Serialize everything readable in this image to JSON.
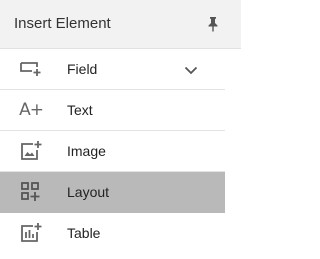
{
  "panel": {
    "title": "Insert Element",
    "pin_icon": "pin-icon"
  },
  "items": [
    {
      "label": "Field",
      "icon": "field-icon",
      "has_chevron": true,
      "active": false
    },
    {
      "label": "Text",
      "icon": "text-icon",
      "glyph": "A+",
      "has_chevron": false,
      "active": false
    },
    {
      "label": "Image",
      "icon": "image-icon",
      "has_chevron": false,
      "active": false
    },
    {
      "label": "Layout",
      "icon": "layout-icon",
      "has_chevron": false,
      "active": true
    },
    {
      "label": "Table",
      "icon": "table-icon",
      "has_chevron": false,
      "active": false
    }
  ],
  "colors": {
    "header_bg": "#f2f2f2",
    "active_bg": "#b9b9b9",
    "icon": "#666666",
    "text": "#222222"
  }
}
